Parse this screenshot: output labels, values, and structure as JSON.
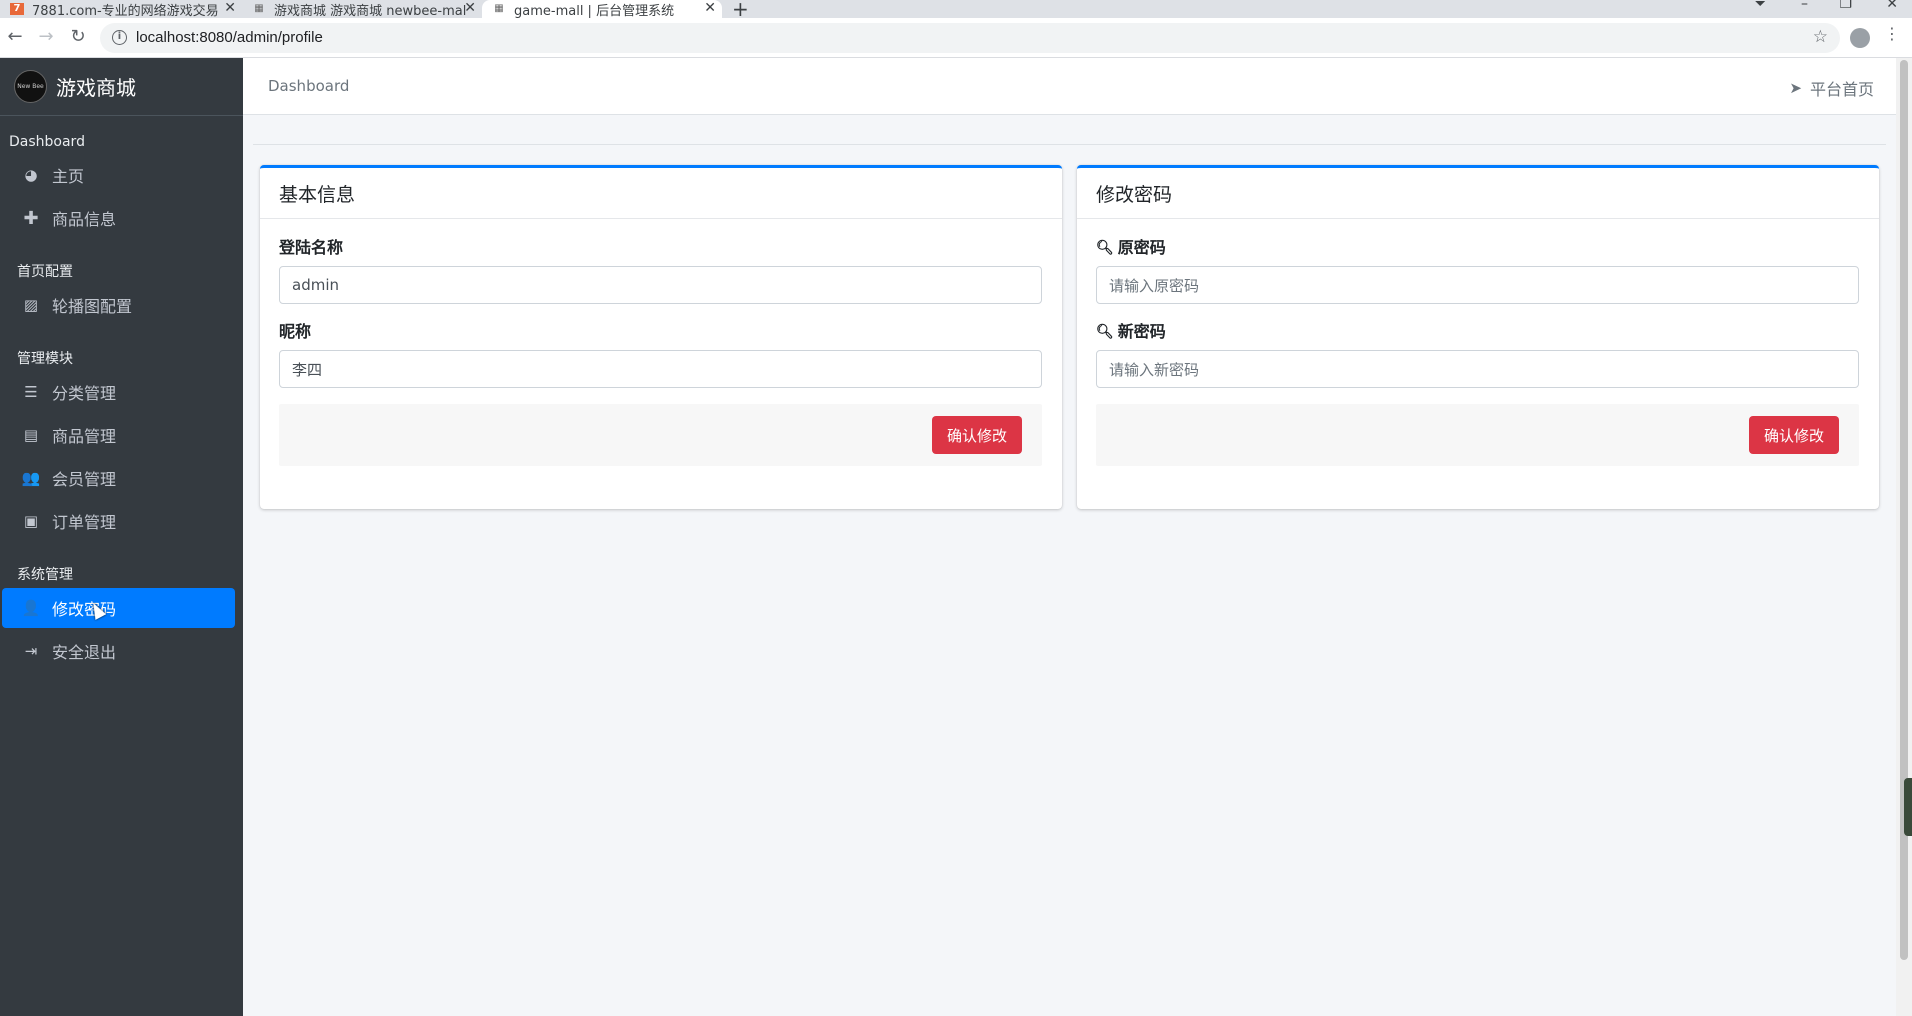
{
  "browser": {
    "tabs": [
      {
        "title": "7881.com-专业的网络游戏交易",
        "favicon": "7881-favicon",
        "active": false
      },
      {
        "title": "游戏商城 游戏商城 newbee-mal",
        "favicon": "grid-favicon",
        "active": false
      },
      {
        "title": "game-mall | 后台管理系统",
        "favicon": "grid-favicon",
        "active": true
      }
    ],
    "new_tab_label": "+",
    "url": "localhost:8080/admin/profile"
  },
  "sidebar": {
    "brand": "游戏商城",
    "logo_text": "New Bee",
    "sections": [
      {
        "header": "Dashboard",
        "items": [
          {
            "label": "主页",
            "icon": "dashboard-icon"
          },
          {
            "label": "商品信息",
            "icon": "plus-icon"
          }
        ]
      },
      {
        "header": "首页配置",
        "items": [
          {
            "label": "轮播图配置",
            "icon": "image-icon"
          }
        ]
      },
      {
        "header": "管理模块",
        "items": [
          {
            "label": "分类管理",
            "icon": "list-icon"
          },
          {
            "label": "商品管理",
            "icon": "archive-icon"
          },
          {
            "label": "会员管理",
            "icon": "users-icon"
          },
          {
            "label": "订单管理",
            "icon": "money-icon"
          }
        ]
      },
      {
        "header": "系统管理",
        "items": [
          {
            "label": "修改密码",
            "icon": "user-secret-icon",
            "active": true
          },
          {
            "label": "安全退出",
            "icon": "sign-out-icon"
          }
        ]
      }
    ]
  },
  "topnav": {
    "breadcrumb": "Dashboard",
    "home_link": "平台首页"
  },
  "basic_info": {
    "title": "基本信息",
    "login_name_label": "登陆名称",
    "login_name_value": "admin",
    "nickname_label": "昵称",
    "nickname_value": "李四",
    "submit_label": "确认修改"
  },
  "change_password": {
    "title": "修改密码",
    "old_label": "原密码",
    "old_placeholder": "请输入原密码",
    "new_label": "新密码",
    "new_placeholder": "请输入新密码",
    "submit_label": "确认修改"
  },
  "colors": {
    "sidebar_bg": "#343a40",
    "accent": "#007bff",
    "danger": "#dc3545",
    "content_bg": "#f4f6f9"
  }
}
